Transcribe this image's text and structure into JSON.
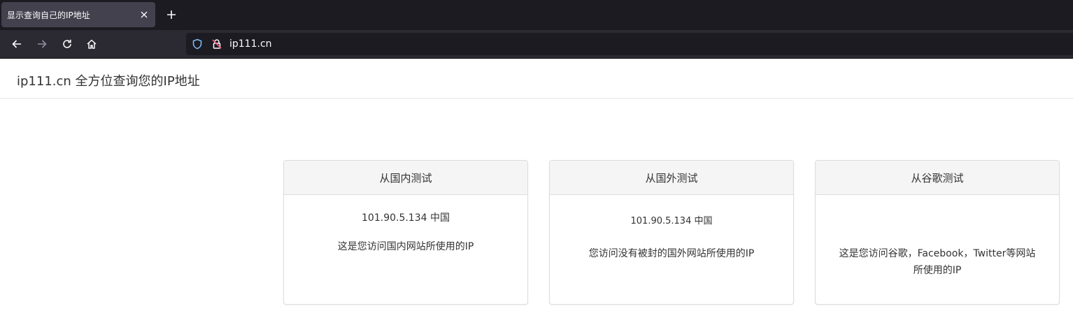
{
  "browser": {
    "tab_title": "显示查询自己的IP地址",
    "url": "ip111.cn"
  },
  "navbar": {
    "brand": "ip111.cn 全方位查询您的IP地址"
  },
  "cards": [
    {
      "title": "从国内测试",
      "ip_line": "101.90.5.134 中国",
      "description": "这是您访问国内网站所使用的IP"
    },
    {
      "title": "从国外测试",
      "ip_line": "101.90.5.134 中国",
      "description": "您访问没有被封的国外网站所使用的IP"
    },
    {
      "title": "从谷歌测试",
      "ip_line": "",
      "description_line1": "这是您访问谷歌，Facebook，Twitter等网站",
      "description_line2": "所使用的IP"
    }
  ],
  "colors": {
    "tabstrip_bg": "#1c1b22",
    "toolbar_bg": "#2b2a33",
    "card_header_bg": "#f5f5f5",
    "text": "#333333"
  }
}
